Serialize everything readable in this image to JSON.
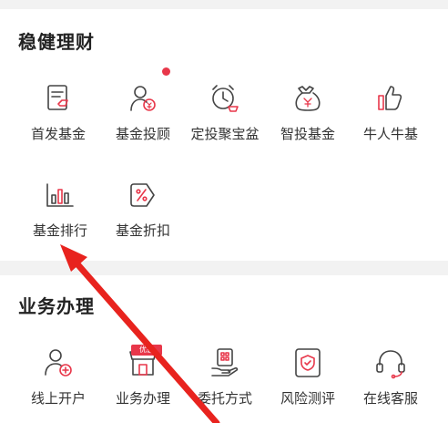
{
  "section1": {
    "title": "稳健理财",
    "items": [
      {
        "label": "首发基金",
        "icon": "fund-document-icon"
      },
      {
        "label": "基金投顾",
        "icon": "advisor-person-icon"
      },
      {
        "label": "定投聚宝盆",
        "icon": "alarm-clock-icon"
      },
      {
        "label": "智投基金",
        "icon": "money-bag-icon"
      },
      {
        "label": "牛人牛基",
        "icon": "thumbs-up-icon"
      },
      {
        "label": "基金排行",
        "icon": "bar-chart-icon"
      },
      {
        "label": "基金折扣",
        "icon": "discount-tag-icon"
      }
    ]
  },
  "section2": {
    "title": "业务办理",
    "badge": "优惠",
    "items": [
      {
        "label": "线上开户",
        "icon": "add-user-icon"
      },
      {
        "label": "业务办理",
        "icon": "storefront-icon"
      },
      {
        "label": "委托方式",
        "icon": "hand-card-icon"
      },
      {
        "label": "风险测评",
        "icon": "shield-check-icon"
      },
      {
        "label": "在线客服",
        "icon": "headset-icon"
      }
    ]
  },
  "colors": {
    "accent": "#e8374a",
    "icon_stroke": "#444444",
    "text": "#333333"
  }
}
